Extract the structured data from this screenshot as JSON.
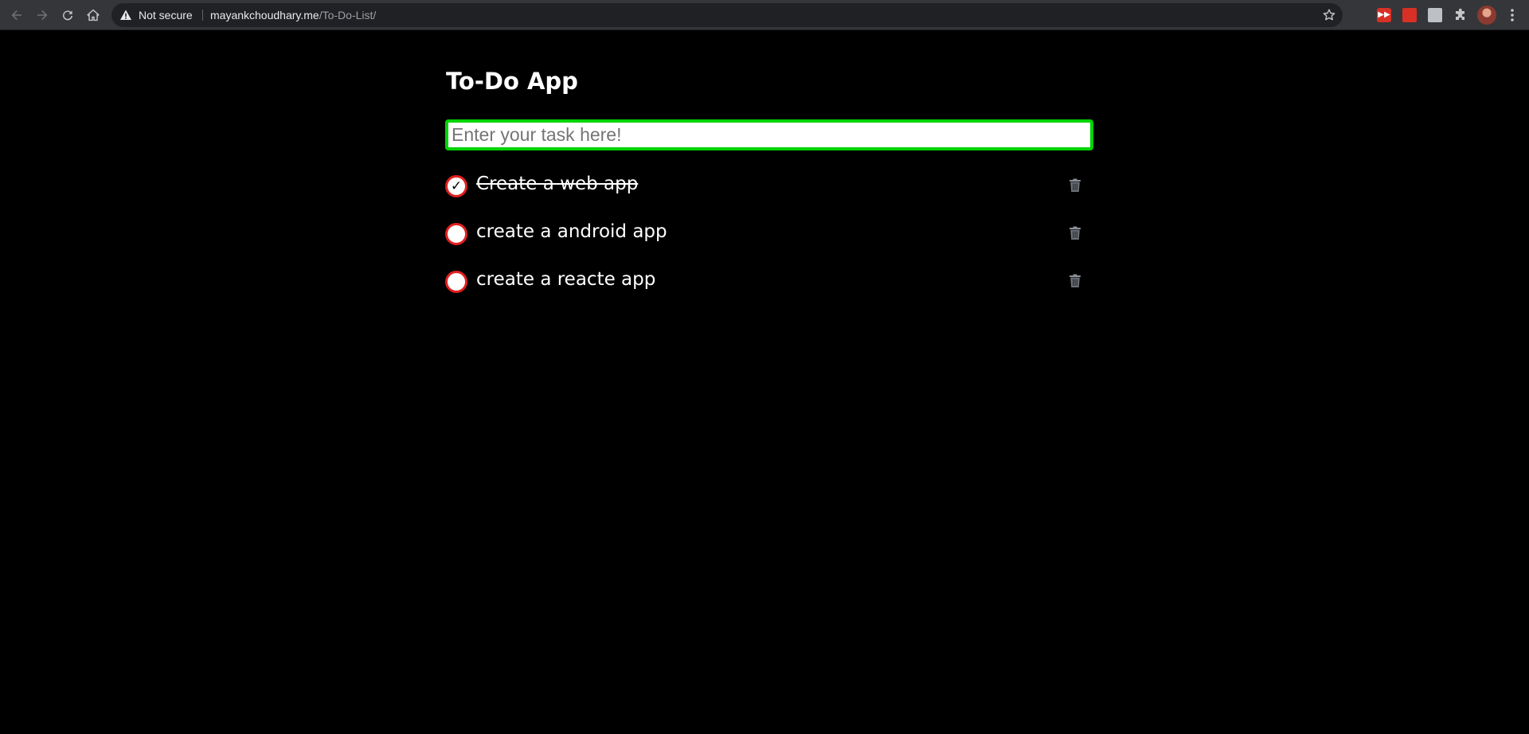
{
  "browser": {
    "security_label": "Not secure",
    "url_host": "mayankchoudhary.me",
    "url_path": "/To-Do-List/",
    "extension_badge": "▶▶"
  },
  "app": {
    "title": "To-Do App",
    "input": {
      "placeholder": "Enter your task here!",
      "value": "",
      "border_color": "#00d400"
    },
    "todos": [
      {
        "text": "Create a web app",
        "done": true,
        "check_mark": "✓"
      },
      {
        "text": "create a android app",
        "done": false,
        "check_mark": ""
      },
      {
        "text": "create a reacte app",
        "done": false,
        "check_mark": ""
      }
    ],
    "checkbox_border_color": "#e02020",
    "background_color": "#000000",
    "text_color": "#ffffff"
  }
}
